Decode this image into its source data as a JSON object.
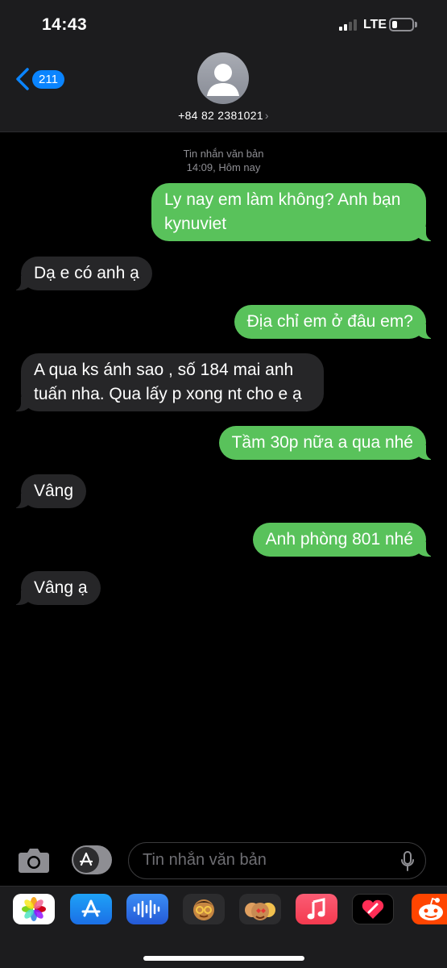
{
  "status_bar": {
    "time": "14:43",
    "network": "LTE",
    "battery_level": 0.25
  },
  "header": {
    "back_badge": "211",
    "contact": "+84 82 2381021",
    "chevron": "›"
  },
  "thread": {
    "meta_type": "Tin nhắn văn bản",
    "meta_time": "14:09, Hôm nay",
    "messages": [
      {
        "dir": "out",
        "text": "Ly nay em làm không? Anh bạn kynuviet"
      },
      {
        "dir": "in",
        "text": "Dạ e có anh ạ"
      },
      {
        "dir": "out",
        "text": "Địa chỉ em ở đâu em?"
      },
      {
        "dir": "in",
        "text": "A qua ks ánh sao , số 184 mai anh tuấn nha. Qua lấy p xong nt cho e ạ"
      },
      {
        "dir": "out",
        "text": "Tầm 30p nữa a qua nhé"
      },
      {
        "dir": "in",
        "text": "Vâng"
      },
      {
        "dir": "out",
        "text": "Anh phòng 801 nhé"
      },
      {
        "dir": "in",
        "text": "Vâng ạ"
      }
    ]
  },
  "composer": {
    "placeholder": "Tin nhắn văn bản"
  },
  "app_drawer": {
    "apps": [
      "photos-icon",
      "app-store-icon",
      "audio-message-icon",
      "memoji-icon",
      "memoji-stickers-icon",
      "music-icon",
      "digital-touch-icon",
      "reddit-icon"
    ]
  },
  "colors": {
    "outgoing": "#59c25b",
    "incoming": "#262628",
    "accent": "#0a84ff"
  }
}
